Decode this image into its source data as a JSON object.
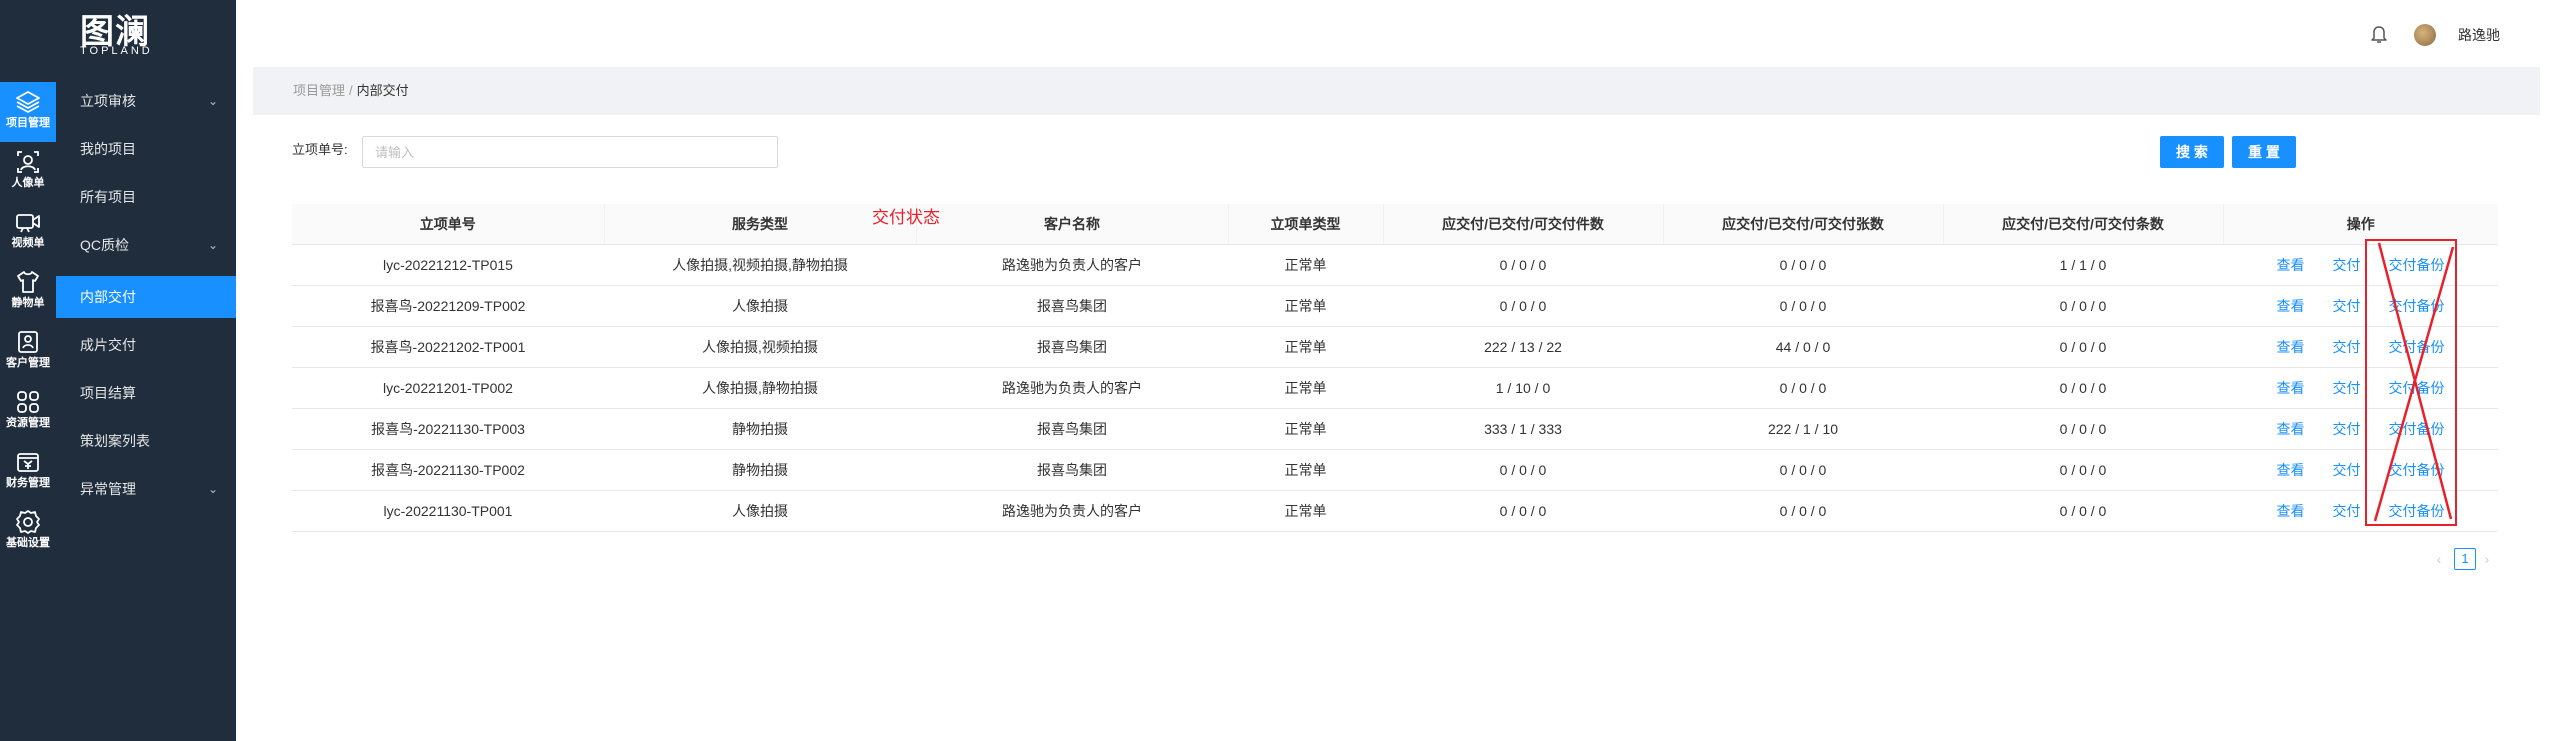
{
  "logo": {
    "mark": "图澜",
    "word": "TOPLAND"
  },
  "rail": [
    {
      "icon": "layers-icon",
      "label": "项目管理"
    },
    {
      "icon": "portrait-icon",
      "label": "人像单"
    },
    {
      "icon": "video-icon",
      "label": "视频单"
    },
    {
      "icon": "shirt-icon",
      "label": "静物单"
    },
    {
      "icon": "contact-icon",
      "label": "客户管理"
    },
    {
      "icon": "grid-icon",
      "label": "资源管理"
    },
    {
      "icon": "finance-icon",
      "label": "财务管理"
    },
    {
      "icon": "gear-icon",
      "label": "基础设置"
    }
  ],
  "menu": [
    {
      "label": "立项审核",
      "expandable": true
    },
    {
      "label": "我的项目"
    },
    {
      "label": "所有项目"
    },
    {
      "label": "QC质检",
      "expandable": true
    },
    {
      "label": "内部交付",
      "active": true
    },
    {
      "label": "成片交付"
    },
    {
      "label": "项目结算"
    },
    {
      "label": "策划案列表"
    },
    {
      "label": "异常管理",
      "expandable": true
    }
  ],
  "header": {
    "user_name": "路逸驰"
  },
  "breadcrumb": {
    "parent": "项目管理",
    "separator": "/",
    "current": "内部交付"
  },
  "filter": {
    "label": "立项单号:",
    "placeholder": "请输入",
    "search_label": "搜 索",
    "reset_label": "重 置"
  },
  "annotation": "交付状态",
  "table": {
    "columns": [
      "立项单号",
      "服务类型",
      "客户名称",
      "立项单类型",
      "应交付/已交付/可交付件数",
      "应交付/已交付/可交付张数",
      "应交付/已交付/可交付条数",
      "操作"
    ],
    "actions": [
      "查看",
      "交付",
      "交付备份"
    ],
    "rows": [
      [
        "lyc-20221212-TP015",
        "人像拍摄,视频拍摄,静物拍摄",
        "路逸驰为负责人的客户",
        "正常单",
        "0 / 0 / 0",
        "0 / 0 / 0",
        "1 / 1 / 0"
      ],
      [
        "报喜鸟-20221209-TP002",
        "人像拍摄",
        "报喜鸟集团",
        "正常单",
        "0 / 0 / 0",
        "0 / 0 / 0",
        "0 / 0 / 0"
      ],
      [
        "报喜鸟-20221202-TP001",
        "人像拍摄,视频拍摄",
        "报喜鸟集团",
        "正常单",
        "222 / 13 / 22",
        "44 / 0 / 0",
        "0 / 0 / 0"
      ],
      [
        "lyc-20221201-TP002",
        "人像拍摄,静物拍摄",
        "路逸驰为负责人的客户",
        "正常单",
        "1 / 10 / 0",
        "0 / 0 / 0",
        "0 / 0 / 0"
      ],
      [
        "报喜鸟-20221130-TP003",
        "静物拍摄",
        "报喜鸟集团",
        "正常单",
        "333 / 1 / 333",
        "222 / 1 / 10",
        "0 / 0 / 0"
      ],
      [
        "报喜鸟-20221130-TP002",
        "静物拍摄",
        "报喜鸟集团",
        "正常单",
        "0 / 0 / 0",
        "0 / 0 / 0",
        "0 / 0 / 0"
      ],
      [
        "lyc-20221130-TP001",
        "人像拍摄",
        "路逸驰为负责人的客户",
        "正常单",
        "0 / 0 / 0",
        "0 / 0 / 0",
        "0 / 0 / 0"
      ]
    ]
  },
  "pagination": {
    "current_page": "1",
    "prev": "‹",
    "next": "›"
  },
  "colors": {
    "sidebar": "#1f2d3d",
    "accent": "#1890ff",
    "annotation": "#e8202a"
  }
}
